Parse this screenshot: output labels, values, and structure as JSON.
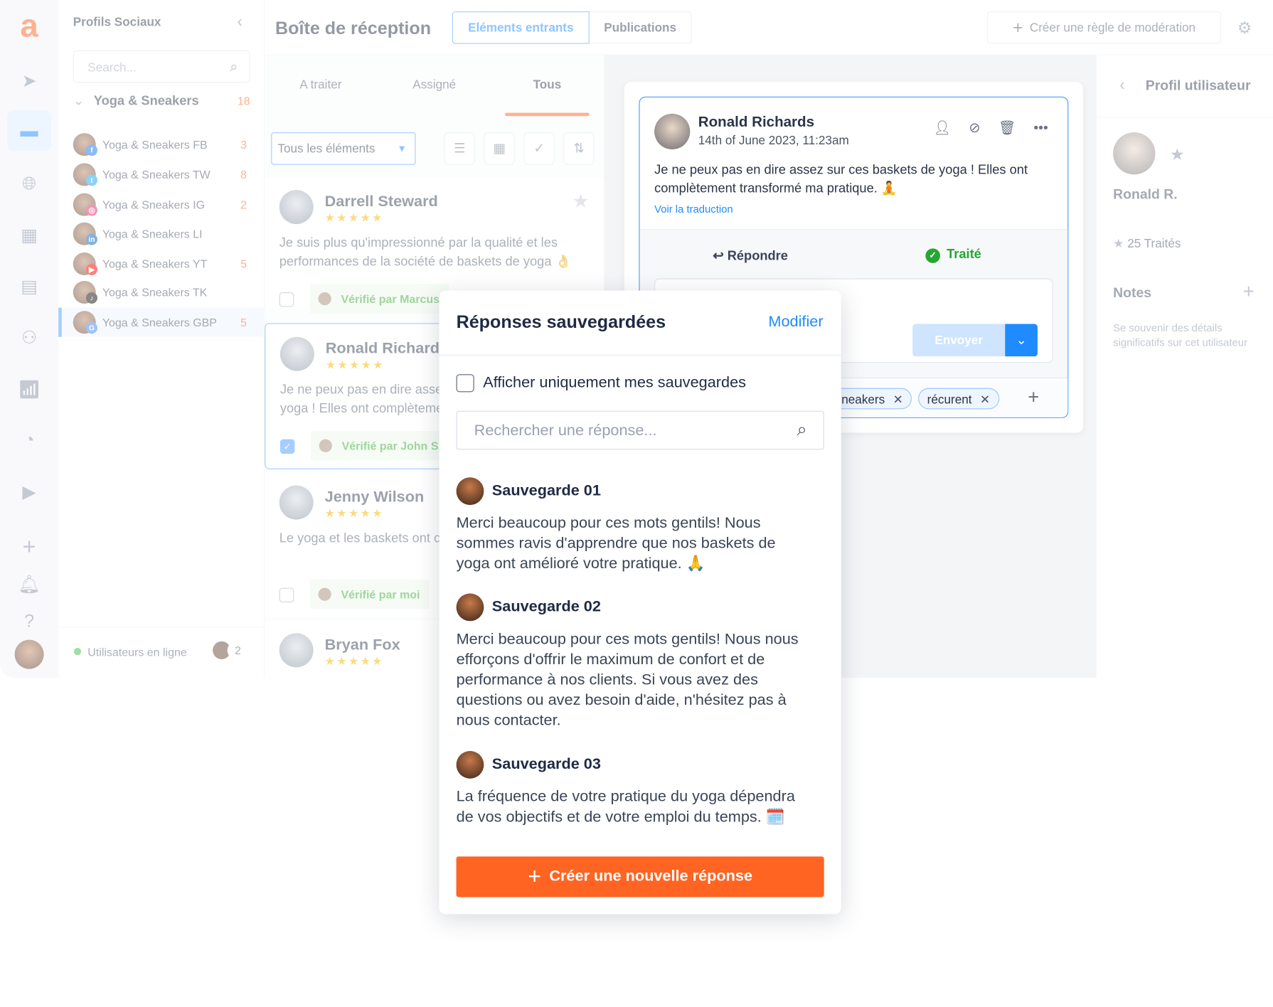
{
  "colors": {
    "accent": "#1f8bff",
    "brand": "#ff6422",
    "success": "#26a632",
    "star": "#f6b70a"
  },
  "rail": {
    "icons": [
      "logo",
      "send-icon",
      "inbox-icon",
      "globe-search-icon",
      "calendar-icon",
      "planner-icon",
      "users-icon",
      "analytics-icon",
      "dashboard-icon",
      "media-icon",
      "plus-icon",
      "bell-icon",
      "help-icon"
    ]
  },
  "sidebar": {
    "title": "Profils Sociaux",
    "search_placeholder": "Search...",
    "group": {
      "label": "Yoga & Sneakers",
      "count": "18"
    },
    "items": [
      {
        "label": "Yoga & Sneakers FB",
        "count": "3",
        "net": "f"
      },
      {
        "label": "Yoga & Sneakers TW",
        "count": "8",
        "net": "t"
      },
      {
        "label": "Yoga & Sneakers IG",
        "count": "2",
        "net": "ig"
      },
      {
        "label": "Yoga & Sneakers LI",
        "count": "",
        "net": "in"
      },
      {
        "label": "Yoga & Sneakers YT",
        "count": "5",
        "net": "yt"
      },
      {
        "label": "Yoga & Sneakers TK",
        "count": "",
        "net": "tk"
      },
      {
        "label": "Yoga & Sneakers GBP",
        "count": "5",
        "net": "g"
      }
    ],
    "online_label": "Utilisateurs en ligne",
    "online_count": "2"
  },
  "header": {
    "title": "Boîte de réception",
    "tabs": [
      "Eléments entrants",
      "Publications"
    ],
    "rule_button": "Créer une règle de modération"
  },
  "list": {
    "tabs": [
      "A traiter",
      "Assigné",
      "Tous"
    ],
    "filter": "Tous les éléments",
    "cards": [
      {
        "name": "Darrell Steward",
        "stars": "★★★★★",
        "text": "Je suis plus qu'impressionné par la qualité et les performances de la société de baskets de yoga 👌",
        "verified": "Vérifié par Marcus"
      },
      {
        "name": "Ronald Richards",
        "stars": "★★★★★",
        "text": "Je ne peux pas en dire assez sur ces baskets de yoga ! Elles ont complètement",
        "verified": "Vérifié par John S."
      },
      {
        "name": "Jenny Wilson",
        "stars": "★★★★★",
        "text": "Le yoga et les baskets ont changé moi ! ❤️",
        "verified": "Vérifié par moi"
      },
      {
        "name": "Bryan Fox",
        "stars": "★★★★★",
        "text": "",
        "verified": ""
      }
    ]
  },
  "detail": {
    "name": "Ronald Richards",
    "date": "14th of June 2023, 11:23am",
    "text": "Je ne peux pas en dire assez sur ces baskets de yoga ! Elles ont complètement transformé ma pratique. 🧘",
    "translate": "Voir la traduction",
    "reply": "Répondre",
    "done": "Traité",
    "send": "Envoyer",
    "tags": [
      "sneakers",
      "récurent"
    ]
  },
  "profile": {
    "title": "Profil utilisateur",
    "name": "Ronald R.",
    "treated": "25 Traités",
    "notes": "Notes",
    "notes_hint": "Se souvenir des détails significatifs sur cet utilisateur"
  },
  "popup": {
    "title": "Réponses sauvegardées",
    "edit": "Modifier",
    "only_mine": "Afficher uniquement mes sauvegardes",
    "search_placeholder": "Rechercher une réponse...",
    "items": [
      {
        "title": "Sauvegarde 01",
        "text": "Merci beaucoup pour ces mots gentils! Nous sommes ravis d'apprendre que nos baskets de yoga ont amélioré votre pratique. 🙏"
      },
      {
        "title": "Sauvegarde 02",
        "text": "Merci beaucoup pour ces mots gentils! Nous nous efforçons d'offrir le maximum de confort et de performance à nos clients. Si vous avez des questions ou avez besoin d'aide, n'hésitez pas à nous contacter."
      },
      {
        "title": "Sauvegarde 03",
        "text": "La fréquence de votre pratique du yoga dépendra de vos objectifs et de votre emploi du temps. 🗓️"
      }
    ],
    "create": "Créer une nouvelle réponse"
  }
}
